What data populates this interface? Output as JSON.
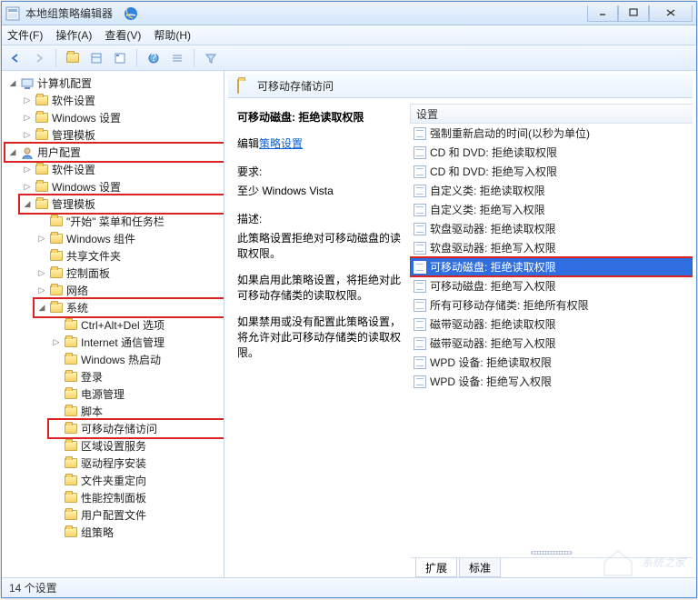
{
  "window": {
    "title": "本地组策略编辑器"
  },
  "menu": {
    "file": "文件(F)",
    "action": "操作(A)",
    "view": "查看(V)",
    "help": "帮助(H)"
  },
  "tree": {
    "root": "计算机配置",
    "root_children": {
      "n1": "软件设置",
      "n2": "Windows 设置",
      "n3": "管理模板"
    },
    "user": "用户配置",
    "user_children": {
      "n1": "软件设置",
      "n2": "Windows 设置",
      "admin": "管理模板"
    },
    "admin_children": {
      "start": "\"开始\" 菜单和任务栏",
      "winc": "Windows 组件",
      "share": "共享文件夹",
      "ctrlpanel": "控制面板",
      "net": "网络",
      "sys": "系统"
    },
    "sys_children": {
      "cad": "Ctrl+Alt+Del 选项",
      "ie": "Internet 通信管理",
      "hot": "Windows 热启动",
      "login": "登录",
      "power": "电源管理",
      "script": "脚本",
      "removable": "可移动存储访问",
      "region": "区域设置服务",
      "drvinst": "驱动程序安装",
      "folder": "文件夹重定向",
      "perf": "性能控制面板",
      "profile": "用户配置文件",
      "gp": "组策略"
    }
  },
  "details": {
    "header": "可移动存储访问",
    "policy_name": "可移动磁盘: 拒绝读取权限",
    "edit_label": "编辑",
    "edit_link": "策略设置",
    "req_label": "要求:",
    "req_value": "至少 Windows Vista",
    "desc_label": "描述:",
    "desc_p1": "此策略设置拒绝对可移动磁盘的读取权限。",
    "desc_p2": "如果启用此策略设置，将拒绝对此可移动存储类的读取权限。",
    "desc_p3": "如果禁用或没有配置此策略设置，将允许对此可移动存储类的读取权限。",
    "col_header": "设置",
    "items": [
      "强制重新启动的时间(以秒为单位)",
      "CD 和 DVD: 拒绝读取权限",
      "CD 和 DVD: 拒绝写入权限",
      "自定义类: 拒绝读取权限",
      "自定义类: 拒绝写入权限",
      "软盘驱动器: 拒绝读取权限",
      "软盘驱动器: 拒绝写入权限",
      "可移动磁盘: 拒绝读取权限",
      "可移动磁盘: 拒绝写入权限",
      "所有可移动存储类: 拒绝所有权限",
      "磁带驱动器: 拒绝读取权限",
      "磁带驱动器: 拒绝写入权限",
      "WPD 设备: 拒绝读取权限",
      "WPD 设备: 拒绝写入权限"
    ],
    "selected_index": 7,
    "tabs": {
      "ext": "扩展",
      "std": "标准"
    }
  },
  "status": "14 个设置",
  "watermark": "系统之家"
}
